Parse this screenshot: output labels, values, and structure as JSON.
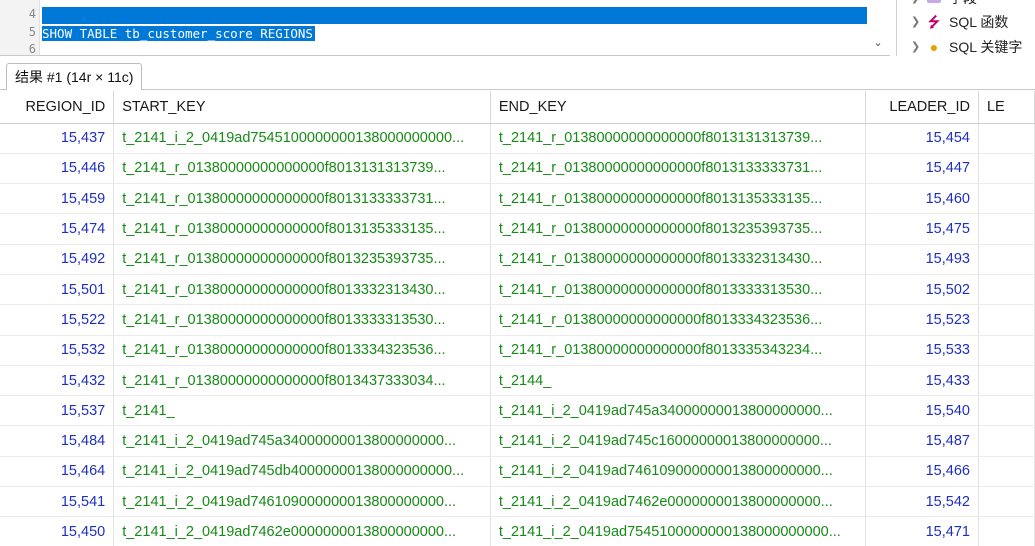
{
  "editor": {
    "lines": [
      {
        "num": "4",
        "text": ""
      },
      {
        "num": "5",
        "text": "SHOW TABLE tb_customer_score REGIONS"
      },
      {
        "num": "6",
        "text": ""
      }
    ]
  },
  "tree": {
    "items": [
      {
        "label": "字段",
        "icon": "folder-icon"
      },
      {
        "label": "SQL 函数",
        "icon": "function-icon"
      },
      {
        "label": "SQL 关键字",
        "icon": "keyword-icon"
      }
    ]
  },
  "result_tab": {
    "label": "结果 #1 (14r × 11c)"
  },
  "grid": {
    "columns": [
      "REGION_ID",
      "START_KEY",
      "END_KEY",
      "LEADER_ID",
      "LE"
    ],
    "rows": [
      {
        "region_id": "15,437",
        "start_key": "t_2141_i_2_0419ad7545100000000138000000000...",
        "end_key": "t_2141_r_01380000000000000f8013131313739...",
        "leader_id": "15,454"
      },
      {
        "region_id": "15,446",
        "start_key": "t_2141_r_01380000000000000f8013131313739...",
        "end_key": "t_2141_r_01380000000000000f8013133333731...",
        "leader_id": "15,447"
      },
      {
        "region_id": "15,459",
        "start_key": "t_2141_r_01380000000000000f8013133333731...",
        "end_key": "t_2141_r_01380000000000000f8013135333135...",
        "leader_id": "15,460"
      },
      {
        "region_id": "15,474",
        "start_key": "t_2141_r_01380000000000000f8013135333135...",
        "end_key": "t_2141_r_01380000000000000f8013235393735...",
        "leader_id": "15,475"
      },
      {
        "region_id": "15,492",
        "start_key": "t_2141_r_01380000000000000f8013235393735...",
        "end_key": "t_2141_r_01380000000000000f8013332313430...",
        "leader_id": "15,493"
      },
      {
        "region_id": "15,501",
        "start_key": "t_2141_r_01380000000000000f8013332313430...",
        "end_key": "t_2141_r_01380000000000000f8013333313530...",
        "leader_id": "15,502"
      },
      {
        "region_id": "15,522",
        "start_key": "t_2141_r_01380000000000000f8013333313530...",
        "end_key": "t_2141_r_01380000000000000f8013334323536...",
        "leader_id": "15,523"
      },
      {
        "region_id": "15,532",
        "start_key": "t_2141_r_01380000000000000f8013334323536...",
        "end_key": "t_2141_r_01380000000000000f8013335343234...",
        "leader_id": "15,533"
      },
      {
        "region_id": "15,432",
        "start_key": "t_2141_r_01380000000000000f8013437333034...",
        "end_key": "t_2144_",
        "leader_id": "15,433"
      },
      {
        "region_id": "15,537",
        "start_key": "t_2141_",
        "end_key": "t_2141_i_2_0419ad745a34000000013800000000...",
        "leader_id": "15,540"
      },
      {
        "region_id": "15,484",
        "start_key": "t_2141_i_2_0419ad745a34000000013800000000...",
        "end_key": "t_2141_i_2_0419ad745c16000000013800000000...",
        "leader_id": "15,487"
      },
      {
        "region_id": "15,464",
        "start_key": "t_2141_i_2_0419ad745db40000000138000000000...",
        "end_key": "t_2141_i_2_0419ad746109000000013800000000...",
        "leader_id": "15,466"
      },
      {
        "region_id": "15,541",
        "start_key": "t_2141_i_2_0419ad746109000000013800000000...",
        "end_key": "t_2141_i_2_0419ad7462e0000000013800000000...",
        "leader_id": "15,542"
      },
      {
        "region_id": "15,450",
        "start_key": "t_2141_i_2_0419ad7462e0000000013800000000...",
        "end_key": "t_2141_i_2_0419ad7545100000000138000000000...",
        "leader_id": "15,471"
      }
    ]
  }
}
